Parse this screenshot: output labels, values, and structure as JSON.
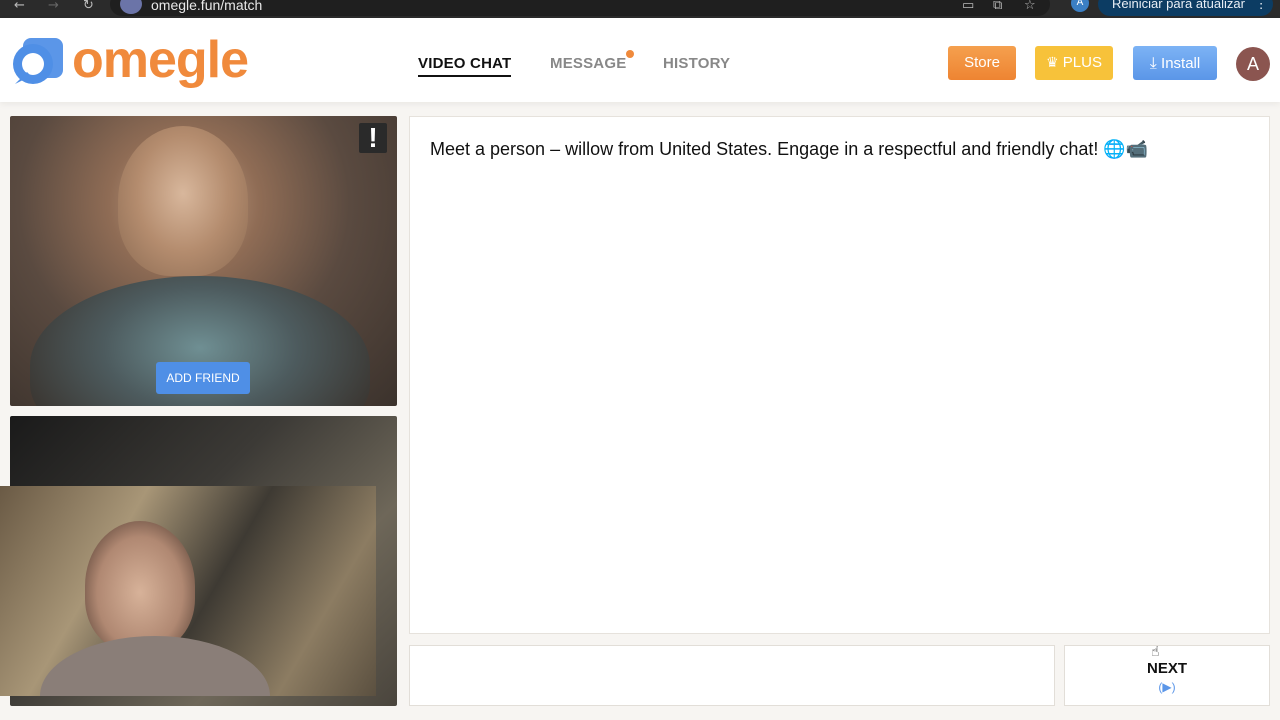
{
  "browser": {
    "url": "omegle.fun/match",
    "profile_initial": "A",
    "update_label": "Reiniciar para atualizar",
    "back_icon": "←",
    "forward_icon": "→",
    "reload_icon": "↻",
    "cast_icon": "▭",
    "translate_icon": "⧉",
    "star_icon": "☆",
    "menu_icon": "⋮"
  },
  "header": {
    "logo_text": "omegle",
    "nav": {
      "video_chat": "VIDEO CHAT",
      "message": "MESSAGE",
      "history": "HISTORY"
    },
    "store_label": "Store",
    "plus_label": "PLUS",
    "plus_icon": "♛",
    "install_label": "Install",
    "install_icon": "⤓",
    "avatar_initial": "A"
  },
  "video": {
    "report_icon": "!",
    "add_friend_label": "ADD FRIEND"
  },
  "chat": {
    "message": "Meet a person – willow from United States. Engage in a respectful and friendly chat! 🌐📹",
    "input_value": "",
    "next_label": "NEXT",
    "next_hint": "(▶)"
  },
  "colors": {
    "brand_orange": "#f08a3c",
    "accent_blue": "#5b96e8",
    "plus_gold": "#f7c23a"
  }
}
